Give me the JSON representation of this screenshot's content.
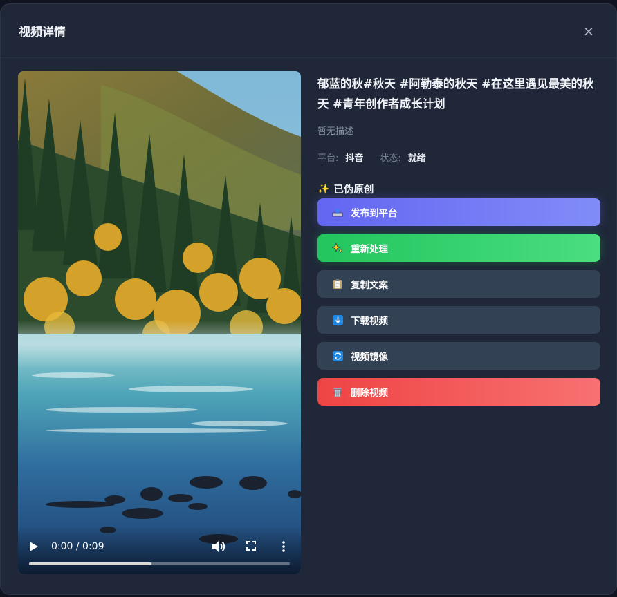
{
  "modal": {
    "title": "视频详情",
    "close_label": "×"
  },
  "video": {
    "time_display": "0:00 / 0:09",
    "progress": 0.47
  },
  "details": {
    "title": "郁蓝的秋#秋天 #阿勒泰的秋天 #在这里遇见最美的秋天 #青年创作者成长计划",
    "description": "暂无描述",
    "platform_label": "平台:",
    "platform_value": "抖音",
    "status_label": "状态:",
    "status_value": "就绪",
    "section_icon": "✨",
    "section_title": "已伪原创"
  },
  "actions": {
    "publish": {
      "label": "发布到平台",
      "icon": "tray-upload-icon"
    },
    "reprocess": {
      "label": "重新处理",
      "icon": "sparkles-icon"
    },
    "copy": {
      "label": "复制文案",
      "icon": "clipboard-icon"
    },
    "download": {
      "label": "下载视频",
      "icon": "download-arrow-icon"
    },
    "mirror": {
      "label": "视频镜像",
      "icon": "refresh-arrows-icon"
    },
    "delete": {
      "label": "删除视频",
      "icon": "trash-can-icon"
    }
  },
  "colors": {
    "publish": "#6366f1",
    "reprocess": "#22c55e",
    "neutral": "#334155",
    "delete": "#ef4444",
    "modal_bg": "#1f2738"
  }
}
